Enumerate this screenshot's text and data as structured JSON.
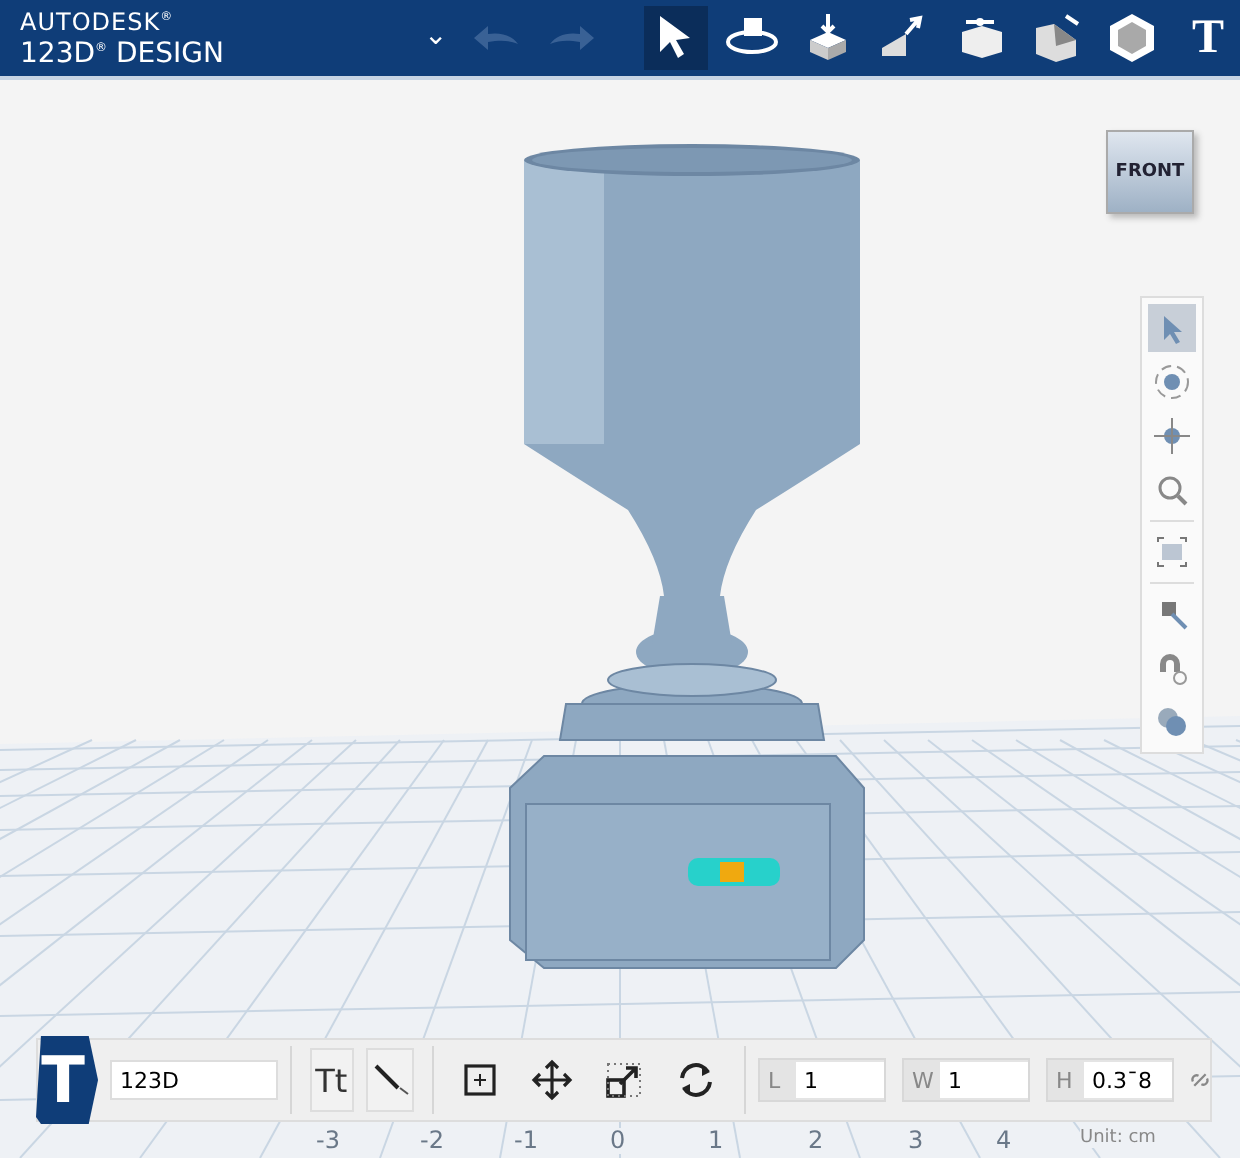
{
  "header": {
    "brand_top": "AUTODESK$^{®}$",
    "brand_bottom": "123D$^{®}$ DESIGN",
    "menu_caret": "⌄"
  },
  "tools": [
    {
      "kind": "undo",
      "disabled": true,
      "selected": false
    },
    {
      "kind": "redo",
      "disabled": true,
      "selected": false
    },
    {
      "kind": "select",
      "disabled": false,
      "selected": true
    },
    {
      "kind": "orbit",
      "disabled": false,
      "selected": false
    },
    {
      "kind": "press",
      "disabled": false,
      "selected": false
    },
    {
      "kind": "extrude",
      "disabled": false,
      "selected": false
    },
    {
      "kind": "tweak",
      "disabled": false,
      "selected": false
    },
    {
      "kind": "fillet",
      "disabled": false,
      "selected": false
    },
    {
      "kind": "solid",
      "disabled": false,
      "selected": false
    },
    {
      "kind": "text",
      "label": "T",
      "disabled": false,
      "selected": false
    }
  ],
  "view_cube": {
    "label": "FRONT"
  },
  "nav_tools": [
    {
      "kind": "select",
      "selected": true
    },
    {
      "kind": "orbit",
      "selected": false
    },
    {
      "kind": "pan",
      "selected": false
    },
    {
      "kind": "zoom",
      "selected": false
    },
    {
      "kind": "fit",
      "selected": false
    },
    {
      "kind": "material",
      "selected": false
    },
    {
      "kind": "snap",
      "selected": false
    },
    {
      "kind": "group",
      "selected": false
    }
  ],
  "ruler_labels": [
    "-3",
    "-2",
    "-1",
    "0",
    "1",
    "2",
    "3",
    "4"
  ],
  "text_toolbar": {
    "badge": "T",
    "text_value": "123D",
    "font_button": "Tt",
    "transform_tools": [
      {
        "kind": "bounds"
      },
      {
        "kind": "move"
      },
      {
        "kind": "scale"
      },
      {
        "kind": "rotate"
      }
    ],
    "fields": [
      {
        "label": "L",
        "value": "1"
      },
      {
        "label": "W",
        "value": "1"
      },
      {
        "label": "H",
        "value": "0.3ˉ8"
      }
    ],
    "unit": "Unit: cm"
  }
}
